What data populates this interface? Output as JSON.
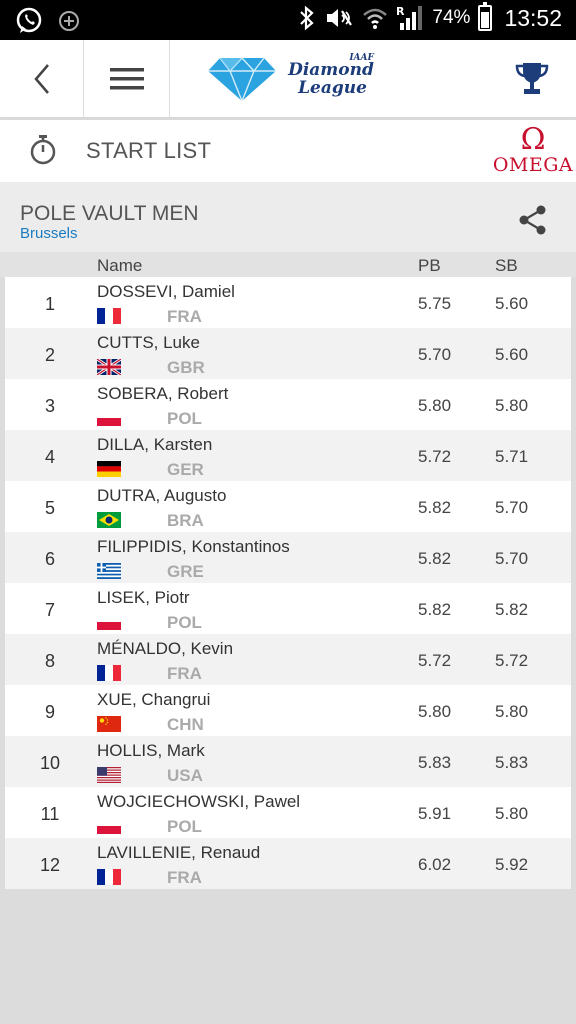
{
  "status_bar": {
    "battery": "74%",
    "time": "13:52",
    "battery_level": 0.74,
    "network": "R"
  },
  "header": {
    "logo_iaaf": "IAAF",
    "logo_line1": "Diamond",
    "logo_line2": "League",
    "brand_color": "#1d3c7a",
    "accent_color": "#2aa3e0"
  },
  "subheader": {
    "title": "START LIST",
    "sponsor_symbol": "Ω",
    "sponsor": "OMEGA",
    "sponsor_color": "#c8102e"
  },
  "event": {
    "title": "POLE VAULT MEN",
    "location": "Brussels"
  },
  "table": {
    "columns": {
      "name": "Name",
      "pb": "PB",
      "sb": "SB"
    },
    "rows": [
      {
        "num": "1",
        "name": "DOSSEVI, Damiel",
        "country": "FRA",
        "pb": "5.75",
        "sb": "5.60"
      },
      {
        "num": "2",
        "name": "CUTTS, Luke",
        "country": "GBR",
        "pb": "5.70",
        "sb": "5.60"
      },
      {
        "num": "3",
        "name": "SOBERA, Robert",
        "country": "POL",
        "pb": "5.80",
        "sb": "5.80"
      },
      {
        "num": "4",
        "name": "DILLA, Karsten",
        "country": "GER",
        "pb": "5.72",
        "sb": "5.71"
      },
      {
        "num": "5",
        "name": "DUTRA, Augusto",
        "country": "BRA",
        "pb": "5.82",
        "sb": "5.70"
      },
      {
        "num": "6",
        "name": "FILIPPIDIS, Konstantinos",
        "country": "GRE",
        "pb": "5.82",
        "sb": "5.70"
      },
      {
        "num": "7",
        "name": "LISEK, Piotr",
        "country": "POL",
        "pb": "5.82",
        "sb": "5.82"
      },
      {
        "num": "8",
        "name": "MÉNALDO, Kevin",
        "country": "FRA",
        "pb": "5.72",
        "sb": "5.72"
      },
      {
        "num": "9",
        "name": "XUE, Changrui",
        "country": "CHN",
        "pb": "5.80",
        "sb": "5.80"
      },
      {
        "num": "10",
        "name": "HOLLIS, Mark",
        "country": "USA",
        "pb": "5.83",
        "sb": "5.83"
      },
      {
        "num": "11",
        "name": "WOJCIECHOWSKI, Pawel",
        "country": "POL",
        "pb": "5.91",
        "sb": "5.80"
      },
      {
        "num": "12",
        "name": "LAVILLENIE, Renaud",
        "country": "FRA",
        "pb": "6.02",
        "sb": "5.92"
      }
    ]
  }
}
